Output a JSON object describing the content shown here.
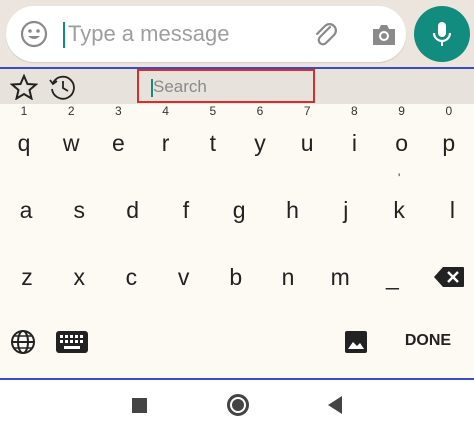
{
  "composer": {
    "placeholder": "Type a message",
    "value": "",
    "icons": {
      "emoji": "emoji-icon",
      "attach": "paperclip-icon",
      "camera": "camera-icon",
      "mic": "mic-icon"
    },
    "accent_color": "#128c7e"
  },
  "emoji_bar": {
    "icons": {
      "favorites": "star-icon",
      "recent": "clock-icon"
    },
    "search_placeholder": "Search",
    "search_value": ""
  },
  "keyboard": {
    "row1": [
      "q",
      "w",
      "e",
      "r",
      "t",
      "y",
      "u",
      "i",
      "o",
      "p"
    ],
    "row1_hints": [
      "1",
      "2",
      "3",
      "4",
      "5",
      "6",
      "7",
      "8",
      "9",
      "0"
    ],
    "row2": [
      "a",
      "s",
      "d",
      "f",
      "g",
      "h",
      "j",
      "k",
      "l"
    ],
    "row2_hints": [
      "",
      "",
      "",
      "",
      "",
      "",
      "",
      "'",
      ""
    ],
    "row3": [
      "z",
      "x",
      "c",
      "v",
      "b",
      "n",
      "m",
      "_"
    ],
    "bottom": {
      "globe": "globe-icon",
      "keyboard": "keyboard-icon",
      "image": "image-icon",
      "backspace": "backspace-icon"
    },
    "done_label": "DONE",
    "frame_color": "#3b4cc0",
    "search_highlight_color": "#d32f2f"
  },
  "navbar": {
    "recents": "square-icon",
    "home": "home-circle-icon",
    "back": "back-triangle-icon"
  }
}
